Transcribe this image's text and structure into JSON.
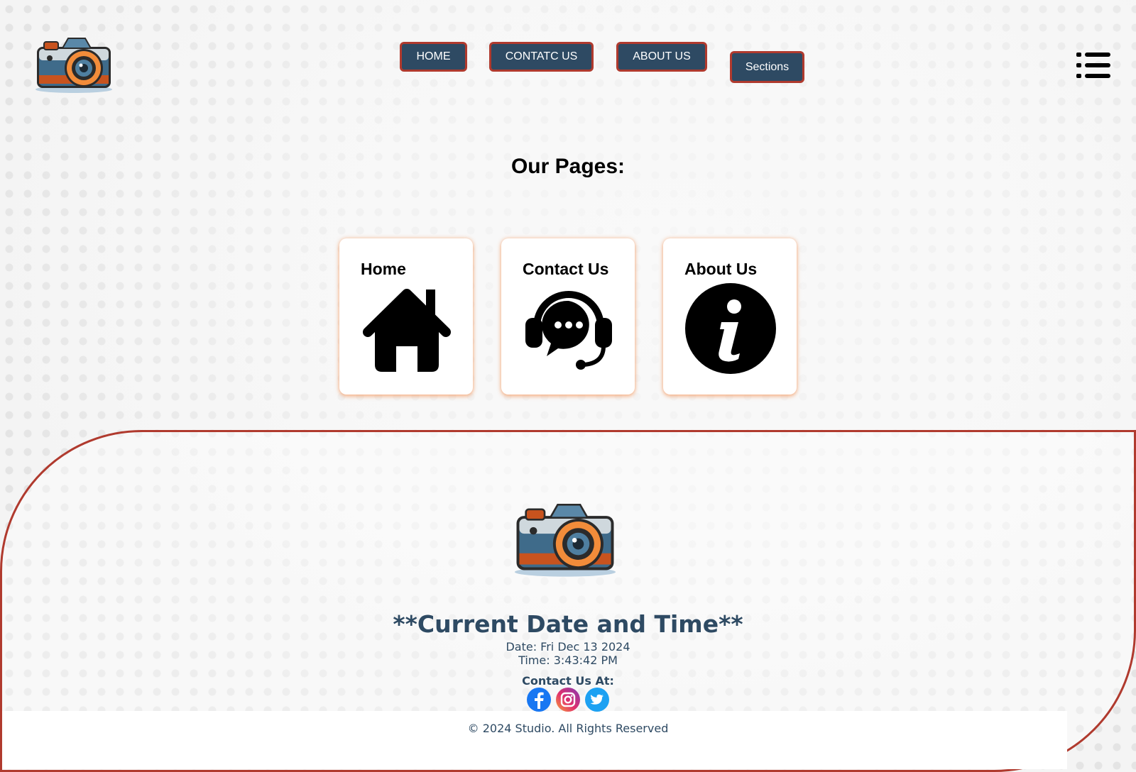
{
  "header": {
    "logo_icon": "camera-icon",
    "nav": [
      {
        "label": "HOME"
      },
      {
        "label": "CONTATC US"
      },
      {
        "label": "ABOUT US"
      },
      {
        "label": "Sections"
      }
    ],
    "menu_icon": "list-menu-icon"
  },
  "main": {
    "title": "Our Pages:",
    "cards": [
      {
        "label": "Home",
        "icon": "house-icon"
      },
      {
        "label": "Contact Us",
        "icon": "headset-chat-icon"
      },
      {
        "label": "About Us",
        "icon": "info-icon"
      }
    ]
  },
  "footer": {
    "logo_icon": "camera-icon",
    "title": "**Current Date and Time**",
    "date": "Date: Fri Dec 13 2024",
    "time": "Time: 3:43:42 PM",
    "contact_label": "Contact Us At:",
    "social": [
      "facebook-icon",
      "instagram-icon",
      "twitter-icon"
    ],
    "copyright": "© 2024 Studio. All Rights Reserved"
  },
  "colors": {
    "nav_bg": "#2e4a63",
    "nav_border": "#b03a2e",
    "footer_text": "#2e4a63",
    "footer_border": "#b03a2e",
    "card_glow": "#f5965a"
  }
}
